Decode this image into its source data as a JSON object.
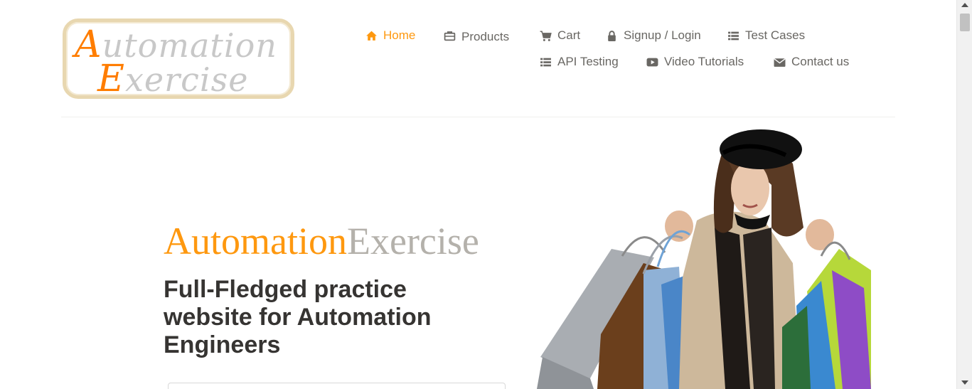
{
  "logo": {
    "line1_cap": "A",
    "line1_rest": "utomation",
    "line2_cap": "E",
    "line2_rest": "xercise"
  },
  "nav": {
    "items": [
      {
        "label": "Home",
        "icon": "home-icon"
      },
      {
        "label": "Products",
        "icon": "briefcase-icon"
      },
      {
        "label": "Cart",
        "icon": "cart-icon"
      },
      {
        "label": "Signup / Login",
        "icon": "lock-icon"
      },
      {
        "label": "Test Cases",
        "icon": "list-icon"
      },
      {
        "label": "API Testing",
        "icon": "list-icon"
      },
      {
        "label": "Video Tutorials",
        "icon": "youtube-icon"
      },
      {
        "label": "Contact us",
        "icon": "envelope-icon"
      }
    ],
    "active_color": "#fe980f",
    "text_color": "#696763"
  },
  "hero": {
    "brand_part1": "Automation",
    "brand_part2": "Exercise",
    "title": "Full-Fledged practice website for Automation Engineers",
    "image": "woman-with-shopping-bags"
  },
  "colors": {
    "accent": "#fe980f",
    "brand_grey": "#b4b1ab",
    "heading": "#363432"
  }
}
